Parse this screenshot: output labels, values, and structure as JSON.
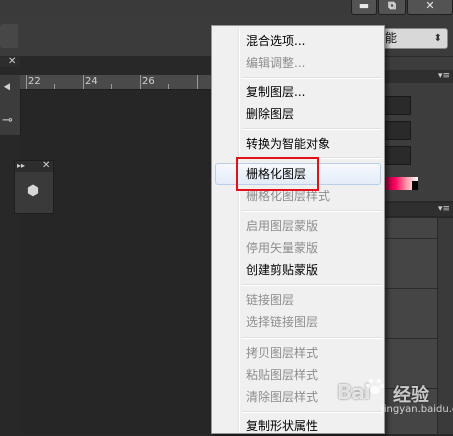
{
  "window_controls": {
    "minimize_icon": "minimize-icon",
    "restore_icon": "restore-icon",
    "close_icon": "close-icon",
    "minimize_glyph": "▬",
    "restore_glyph": "⧉",
    "close_glyph": "✕"
  },
  "options_bar": {
    "blend_mode_value": "能",
    "blend_mode_arrow": "⬍"
  },
  "panels": {
    "close_glyph": "✕",
    "collapse_glyph": "▸▸",
    "menu_glyph": "▾≡"
  },
  "ruler": {
    "ticks": [
      "22",
      "24",
      "26"
    ]
  },
  "context_menu": {
    "items": [
      {
        "label": "混合选项...",
        "enabled": true
      },
      {
        "label": "编辑调整...",
        "enabled": false
      },
      {
        "label": "复制图层...",
        "enabled": true
      },
      {
        "label": "删除图层",
        "enabled": true
      },
      {
        "label": "转换为智能对象",
        "enabled": true
      },
      {
        "label": "栅格化图层",
        "enabled": true,
        "highlighted": true
      },
      {
        "label": "栅格化图层样式",
        "enabled": false
      },
      {
        "label": "启用图层蒙版",
        "enabled": false
      },
      {
        "label": "停用矢量蒙版",
        "enabled": false
      },
      {
        "label": "创建剪贴蒙版",
        "enabled": true
      },
      {
        "label": "链接图层",
        "enabled": false
      },
      {
        "label": "选择链接图层",
        "enabled": false
      },
      {
        "label": "拷贝图层样式",
        "enabled": false
      },
      {
        "label": "粘贴图层样式",
        "enabled": false
      },
      {
        "label": "清除图层样式",
        "enabled": false
      },
      {
        "label": "复制形状属性",
        "enabled": true
      }
    ]
  },
  "watermark": {
    "brand": "Bai",
    "brand_suffix": "经验",
    "url": "jingyan.baidu.com"
  },
  "colors": {
    "highlight_border": "#e5111a",
    "menu_bg": "#f0f0f0",
    "app_bg": "#282828"
  }
}
